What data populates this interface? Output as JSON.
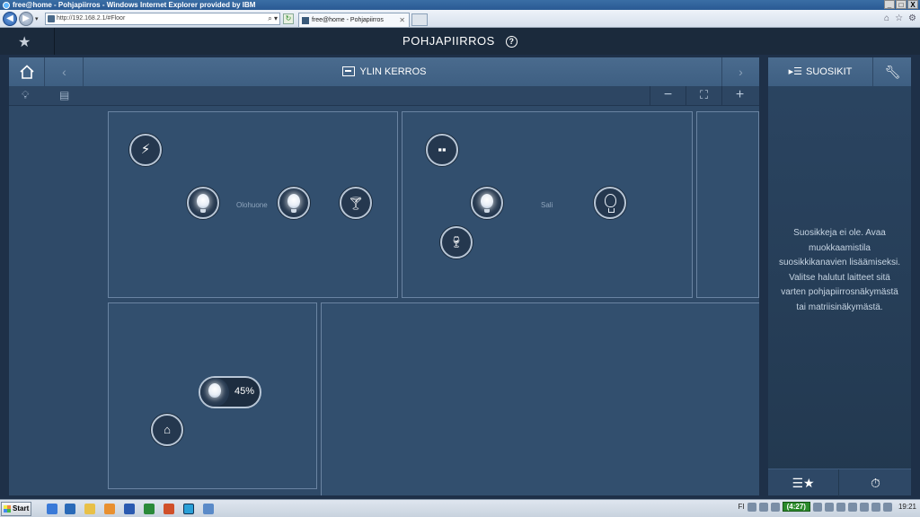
{
  "browser": {
    "window_title": "free@home - Pohjapiirros - Windows Internet Explorer provided by IBM",
    "address": "http://192.168.2.1/#Floor",
    "tab_title": "free@home - Pohjapiirros",
    "win_minimize": "_",
    "win_maximize": "□",
    "win_close": "X",
    "tab_close": "✕"
  },
  "header": {
    "title": "POHJAPIIRROS",
    "help_glyph": "?"
  },
  "floor": {
    "name": "YLIN KERROS",
    "prev": "‹",
    "next": "›",
    "zoom_out": "−",
    "zoom_fit": "⛶",
    "zoom_in": "+"
  },
  "rooms": [
    {
      "label": "Olohuone"
    },
    {
      "label": "Sali"
    },
    {
      "label": ""
    }
  ],
  "devices": {
    "dimmer_level_pct": 45,
    "dimmer_label": "45%"
  },
  "favorites": {
    "title": "SUOSIKIT",
    "empty_message": "Suosikkeja ei ole. Avaa muokkaamistila suosikkikanavien lisäämiseksi. Valitse halutut laitteet sitä varten pohjapiirrosnäkymästä tai matriisinäkymästä."
  },
  "taskbar": {
    "start": "Start",
    "lang": "FI",
    "battery": "(4:27)",
    "clock": "19:21"
  }
}
